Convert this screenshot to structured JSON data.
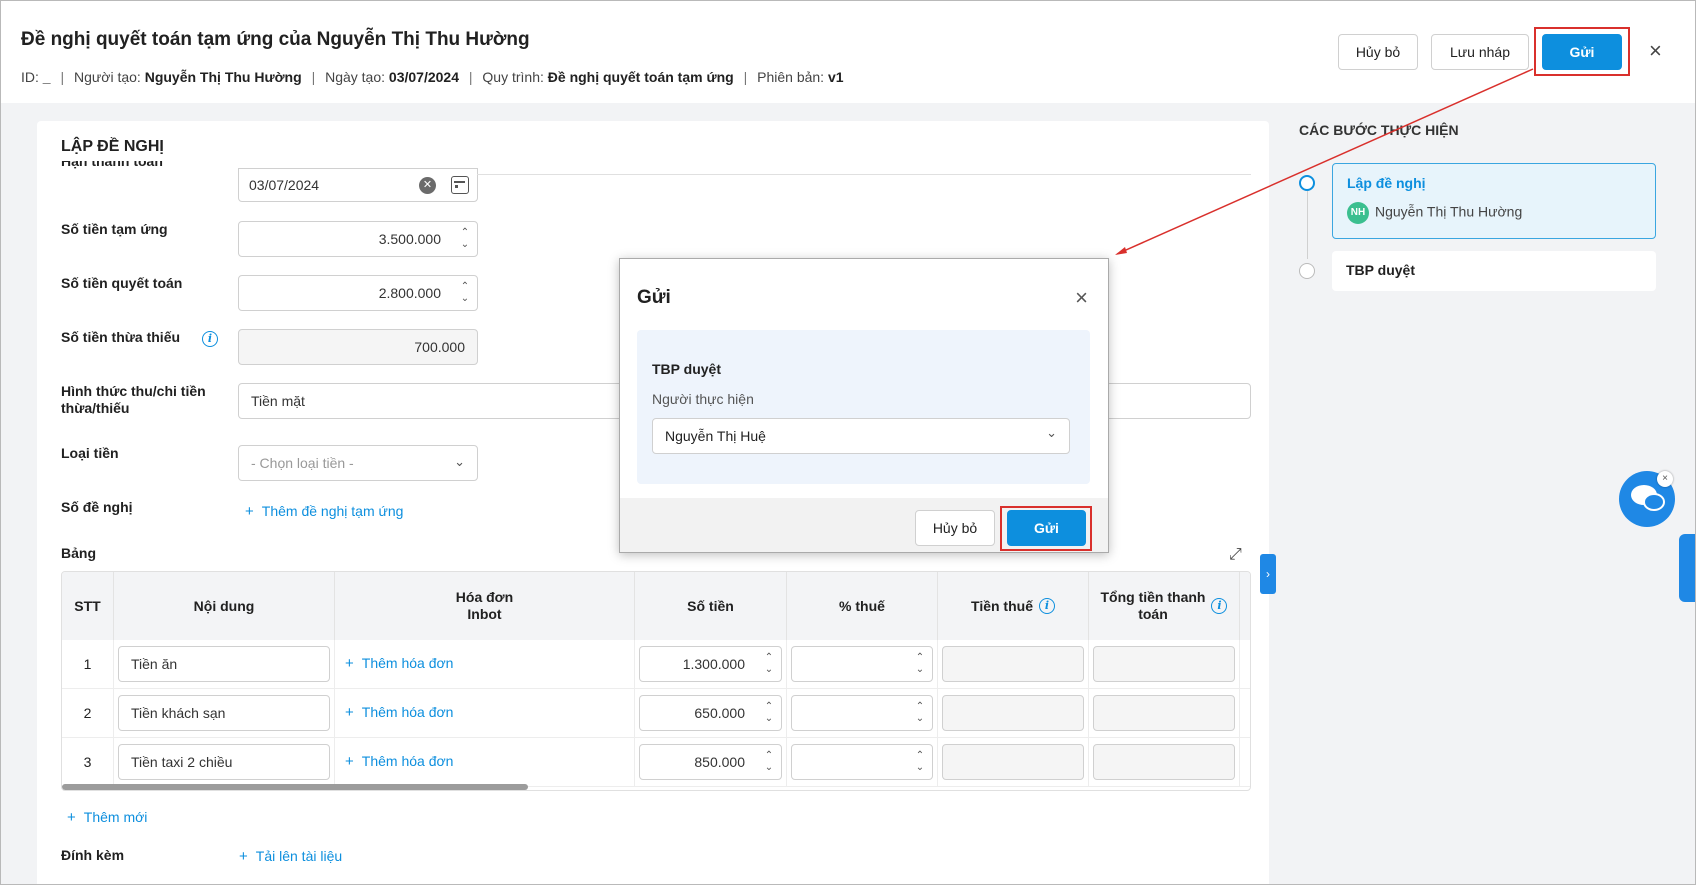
{
  "header": {
    "title": "Đề nghị quyết toán tạm ứng của Nguyễn Thị Thu Hường",
    "meta": {
      "id_label": "ID:",
      "id_value": "_",
      "creator_label": "Người tạo:",
      "creator_value": "Nguyễn Thị Thu Hường",
      "date_label": "Ngày tạo:",
      "date_value": "03/07/2024",
      "process_label": "Quy trình:",
      "process_value": "Đề nghị quyết toán tạm ứng",
      "version_label": "Phiên bản:",
      "version_value": "v1",
      "separator": "|"
    },
    "cancel_label": "Hủy bỏ",
    "draft_label": "Lưu nháp",
    "send_label": "Gửi",
    "close_icon": "×"
  },
  "form": {
    "section_title": "LẬP ĐỀ NGHỊ",
    "due_date_label": "Hạn thanh toán",
    "due_date_value": "03/07/2024",
    "advance_label": "Số tiền tạm ứng",
    "advance_value": "3.500.000",
    "settle_label": "Số tiền quyết toán",
    "settle_value": "2.800.000",
    "diff_label": "Số tiền thừa thiếu",
    "diff_value": "700.000",
    "method_label": "Hình thức thu/chi tiền thừa/thiếu",
    "method_value": "Tiền mặt",
    "currency_label": "Loại tiền",
    "currency_placeholder": "- Chọn loại tiền -",
    "request_no_label": "Số đề nghị",
    "add_advance_link": "Thêm đề nghị tạm ứng",
    "table_label": "Bảng",
    "add_new_link": "Thêm mới",
    "attach_label": "Đính kèm",
    "upload_link": "Tải lên tài liệu"
  },
  "table": {
    "headers": {
      "stt": "STT",
      "content": "Nội dung",
      "invoice_line1": "Hóa đơn",
      "invoice_line2": "Inbot",
      "amount": "Số tiền",
      "tax_pct": "% thuế",
      "tax_amount": "Tiền thuế",
      "total_line1": "Tổng tiền thanh",
      "total_line2": "toán"
    },
    "add_invoice_link": "Thêm hóa đơn",
    "rows": [
      {
        "stt": "1",
        "content": "Tiền ăn",
        "amount": "1.300.000"
      },
      {
        "stt": "2",
        "content": "Tiền khách sạn",
        "amount": "650.000"
      },
      {
        "stt": "3",
        "content": "Tiền taxi 2 chiều",
        "amount": "850.000"
      }
    ]
  },
  "steps": {
    "title": "CÁC BƯỚC THỰC HIỆN",
    "items": [
      {
        "name": "Lập đề nghị",
        "assignee": "Nguyễn Thị Thu Hường",
        "initials": "NH"
      },
      {
        "name": "TBP duyệt"
      }
    ]
  },
  "modal": {
    "title": "Gửi",
    "step_name": "TBP duyệt",
    "performer_label": "Người thực hiện",
    "performer_value": "Nguyễn Thị Huệ",
    "cancel_label": "Hủy bỏ",
    "send_label": "Gửi"
  },
  "colors": {
    "primary": "#0d8fde",
    "highlight_box": "#d9302c",
    "avatar": "#3bbf8f"
  }
}
